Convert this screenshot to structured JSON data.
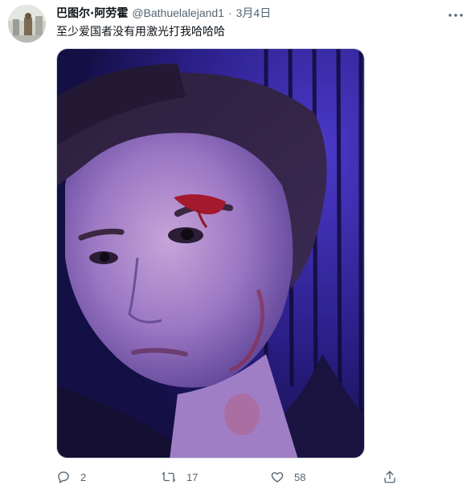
{
  "tweet": {
    "author": {
      "display_name": "巴图尔·阿劳霍",
      "handle": "@Bathuelalejand1",
      "avatar_icon": "user-avatar"
    },
    "separator": "·",
    "date": "3月4日",
    "text": "至少爱国者没有用激光打我哈哈哈",
    "media_alt": "selfie photo with injured eyebrow under purple light",
    "actions": {
      "reply_count": "2",
      "retweet_count": "17",
      "like_count": "58"
    },
    "icons": {
      "more": "more-dots-icon",
      "reply": "reply-icon",
      "retweet": "retweet-icon",
      "like": "heart-icon",
      "share": "share-icon"
    },
    "colors": {
      "text": "#0f1419",
      "muted": "#536471",
      "border": "#cfd9de"
    }
  }
}
